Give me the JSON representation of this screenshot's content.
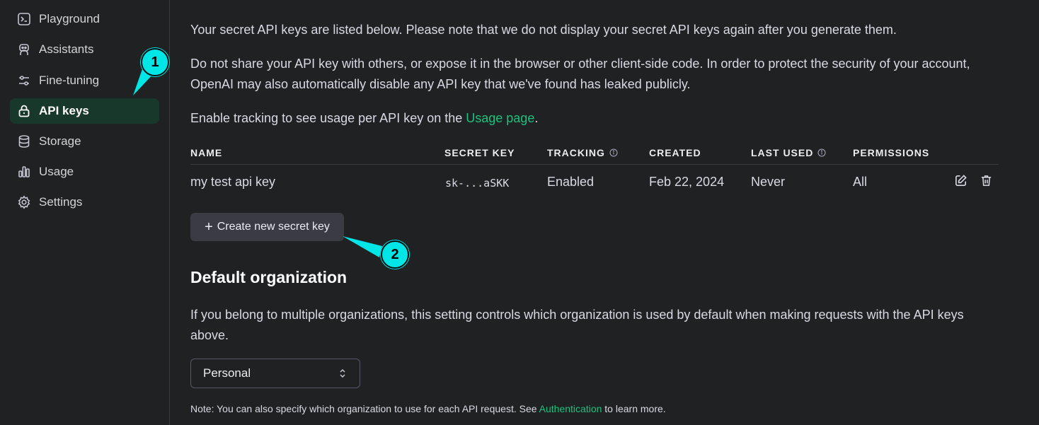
{
  "sidebar": {
    "items": [
      {
        "label": "Playground",
        "icon": "terminal-icon"
      },
      {
        "label": "Assistants",
        "icon": "robot-icon"
      },
      {
        "label": "Fine-tuning",
        "icon": "sliders-icon"
      },
      {
        "label": "API keys",
        "icon": "lock-icon",
        "active": true
      },
      {
        "label": "Storage",
        "icon": "database-icon"
      },
      {
        "label": "Usage",
        "icon": "bar-chart-icon"
      },
      {
        "label": "Settings",
        "icon": "gear-icon"
      }
    ]
  },
  "main": {
    "intro": "Your secret API keys are listed below. Please note that we do not display your secret API keys again after you generate them.",
    "warning": "Do not share your API key with others, or expose it in the browser or other client-side code. In order to protect the security of your account, OpenAI may also automatically disable any API key that we've found has leaked publicly.",
    "tracking_prefix": "Enable tracking to see usage per API key on the ",
    "tracking_link": "Usage page",
    "tracking_suffix": ".",
    "table": {
      "headers": {
        "name": "NAME",
        "secret_key": "SECRET KEY",
        "tracking": "TRACKING",
        "created": "CREATED",
        "last_used": "LAST USED",
        "permissions": "PERMISSIONS"
      },
      "rows": [
        {
          "name": "my test api key",
          "secret_key": "sk-...aSKK",
          "tracking": "Enabled",
          "created": "Feb 22, 2024",
          "last_used": "Never",
          "permissions": "All"
        }
      ]
    },
    "create_button": {
      "icon": "+",
      "label": "Create new secret key"
    },
    "default_org": {
      "title": "Default organization",
      "description": "If you belong to multiple organizations, this setting controls which organization is used by default when making requests with the API keys above.",
      "selected": "Personal",
      "note_prefix": "Note: You can also specify which organization to use for each API request. See ",
      "note_link": "Authentication",
      "note_suffix": " to learn more."
    }
  },
  "callouts": [
    {
      "number": "1"
    },
    {
      "number": "2"
    }
  ],
  "colors": {
    "background": "#202123",
    "accent": "#19c37d",
    "active_nav": "#18382c",
    "callout": "#00e5e5"
  }
}
